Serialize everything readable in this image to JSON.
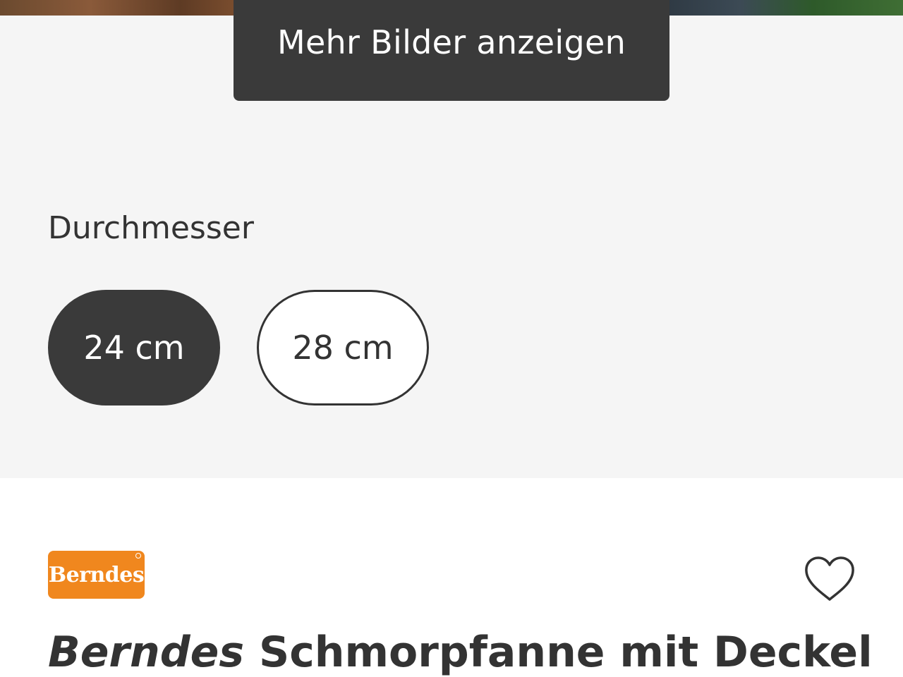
{
  "gallery": {
    "more_images_label": "Mehr Bilder anzeigen"
  },
  "variant": {
    "label": "Durchmesser",
    "options": [
      {
        "label": "24 cm",
        "selected": true
      },
      {
        "label": "28 cm",
        "selected": false
      }
    ]
  },
  "product": {
    "brand_logo_text": "Berndes",
    "brand_name": "Berndes",
    "title": "Schmorpfanne mit Deckel",
    "wishlist_icon": "heart-outline-icon"
  },
  "colors": {
    "dark": "#3a3a3a",
    "brand_orange": "#f0871e",
    "background_gray": "#f5f5f5"
  }
}
